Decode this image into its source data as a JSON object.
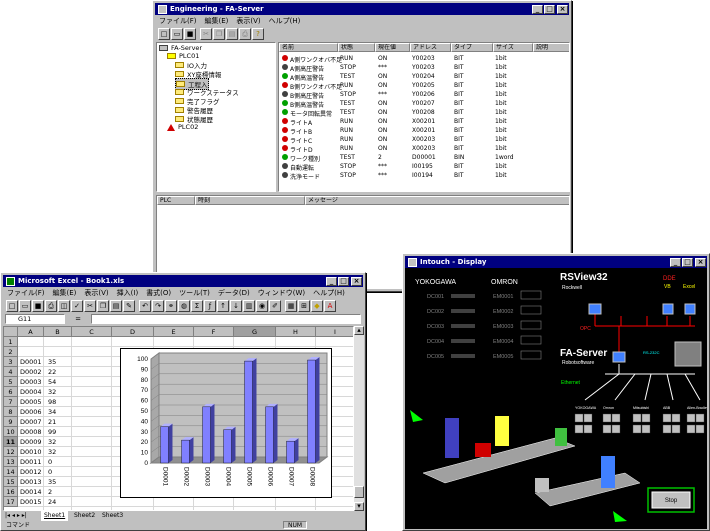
{
  "eng": {
    "title": "Engineering - FA-Server",
    "menu": [
      "ファイル(F)",
      "編集(E)",
      "表示(V)",
      "ヘルプ(H)"
    ],
    "tree": [
      "FA-Server",
      "PLC01",
      "IO入力",
      "XY座標情報",
      "工程入",
      "ワークステータス",
      "完了フラグ",
      "警告履歴",
      "状態履歴",
      "PLC02"
    ],
    "columns": [
      "名前",
      "状態",
      "現在値",
      "アドレス",
      "タイプ",
      "サイズ",
      "説明"
    ],
    "rows": [
      {
        "name": "A側ワンクオバ不足",
        "status": "RUN",
        "val": "ON",
        "addr": "Y00203",
        "type": "BIT",
        "size": "1bit",
        "c": "#d00000"
      },
      {
        "name": "A側高圧警告",
        "status": "STOP",
        "val": "***",
        "addr": "Y00203",
        "type": "BIT",
        "size": "1bit",
        "c": "#404040"
      },
      {
        "name": "A側高温警告",
        "status": "TEST",
        "val": "ON",
        "addr": "Y00204",
        "type": "BIT",
        "size": "1bit",
        "c": "#00a000"
      },
      {
        "name": "B側ワンクオバ不足",
        "status": "RUN",
        "val": "ON",
        "addr": "Y00205",
        "type": "BIT",
        "size": "1bit",
        "c": "#d00000"
      },
      {
        "name": "B側高圧警告",
        "status": "STOP",
        "val": "***",
        "addr": "Y00206",
        "type": "BIT",
        "size": "1bit",
        "c": "#404040"
      },
      {
        "name": "B側高温警告",
        "status": "TEST",
        "val": "ON",
        "addr": "Y00207",
        "type": "BIT",
        "size": "1bit",
        "c": "#00a000"
      },
      {
        "name": "モータ回転異常",
        "status": "TEST",
        "val": "ON",
        "addr": "Y00208",
        "type": "BIT",
        "size": "1bit",
        "c": "#00a000"
      },
      {
        "name": "ライトA",
        "status": "RUN",
        "val": "ON",
        "addr": "X00201",
        "type": "BIT",
        "size": "1bit",
        "c": "#d00000"
      },
      {
        "name": "ライトB",
        "status": "RUN",
        "val": "ON",
        "addr": "X00201",
        "type": "BIT",
        "size": "1bit",
        "c": "#d00000"
      },
      {
        "name": "ライトC",
        "status": "RUN",
        "val": "ON",
        "addr": "X00203",
        "type": "BIT",
        "size": "1bit",
        "c": "#d00000"
      },
      {
        "name": "ライトD",
        "status": "RUN",
        "val": "ON",
        "addr": "X00203",
        "type": "BIT",
        "size": "1bit",
        "c": "#d00000"
      },
      {
        "name": "ワーク種別",
        "status": "TEST",
        "val": "2",
        "addr": "D00001",
        "type": "BIN",
        "size": "1word",
        "c": "#00a000"
      },
      {
        "name": "自動運転",
        "status": "STOP",
        "val": "***",
        "addr": "I00195",
        "type": "BIT",
        "size": "1bit",
        "c": "#404040"
      },
      {
        "name": "洗浄モード",
        "status": "STOP",
        "val": "***",
        "addr": "I00194",
        "type": "BIT",
        "size": "1bit",
        "c": "#404040"
      }
    ],
    "log_columns": [
      "PLC",
      "時刻",
      "メッセージ"
    ]
  },
  "excel": {
    "title": "Microsoft Excel - Book1.xls",
    "menu": [
      "ファイル(F)",
      "編集(E)",
      "表示(V)",
      "挿入(I)",
      "書式(O)",
      "ツール(T)",
      "データ(D)",
      "ウィンドウ(W)",
      "ヘルプ(H)"
    ],
    "namebox": "G11",
    "eq": "=",
    "col_headers": [
      "A",
      "B",
      "C",
      "D",
      "E",
      "F",
      "G",
      "H",
      "I"
    ],
    "row_nums": [
      "1",
      "2",
      "3",
      "4",
      "5",
      "6",
      "7",
      "8",
      "9",
      "10",
      "11",
      "12",
      "13",
      "14",
      "15",
      "16",
      "17"
    ],
    "cells": [
      [
        "",
        ""
      ],
      [
        "",
        ""
      ],
      [
        "",
        ""
      ],
      [
        "D0001",
        "35"
      ],
      [
        "D0002",
        "22"
      ],
      [
        "D0003",
        "54"
      ],
      [
        "D0004",
        "32"
      ],
      [
        "D0005",
        "98"
      ],
      [
        "D0006",
        "34"
      ],
      [
        "D0007",
        "21"
      ],
      [
        "D0008",
        "99"
      ],
      [
        "D0009",
        "32"
      ],
      [
        "D0010",
        "32"
      ],
      [
        "D0011",
        "0"
      ],
      [
        "D0012",
        "0"
      ],
      [
        "D0013",
        "35"
      ],
      [
        "D0014",
        "2"
      ],
      [
        "D0015",
        "24"
      ]
    ],
    "sheets": [
      "Sheet1",
      "Sheet2",
      "Sheet3"
    ],
    "status": "コマンド",
    "numlock": "NUM"
  },
  "chart_data": {
    "type": "bar",
    "categories": [
      "D0001",
      "D0002",
      "D0003",
      "D0004",
      "D0005",
      "D0006",
      "D0007",
      "D0008"
    ],
    "values": [
      35,
      22,
      54,
      32,
      98,
      54,
      21,
      99
    ],
    "ylim": [
      0,
      100
    ],
    "yticks": [
      "0",
      "10",
      "20",
      "30",
      "40",
      "50",
      "60",
      "70",
      "80",
      "90",
      "100"
    ],
    "grid": true,
    "bar_color": "#8080ff"
  },
  "rs": {
    "title": "Intouch - Display",
    "yokogawa": "YOKOGAWA",
    "omron": "OMRON",
    "dc_labels": [
      "DC001",
      "DC002",
      "DC003",
      "DC004",
      "DC005"
    ],
    "em_labels": [
      "EM0001",
      "EM0002",
      "EM0003",
      "EM0004",
      "EM0005"
    ],
    "rsview": "RSView32",
    "rsview_sub": "Rockwell",
    "dde": "DDE",
    "vb": "VB",
    "excel": "Excel",
    "opc": "OPC",
    "fa": "FA-Server",
    "fa_sub": "Robotsoftware",
    "rs232": "RS-232C",
    "ethernet": "Ethernet",
    "nodes": [
      "YOKOGAWA",
      "Omron",
      "Mitsubishi",
      "ABB",
      "Allen-Bradley"
    ],
    "stop": "Stop"
  }
}
